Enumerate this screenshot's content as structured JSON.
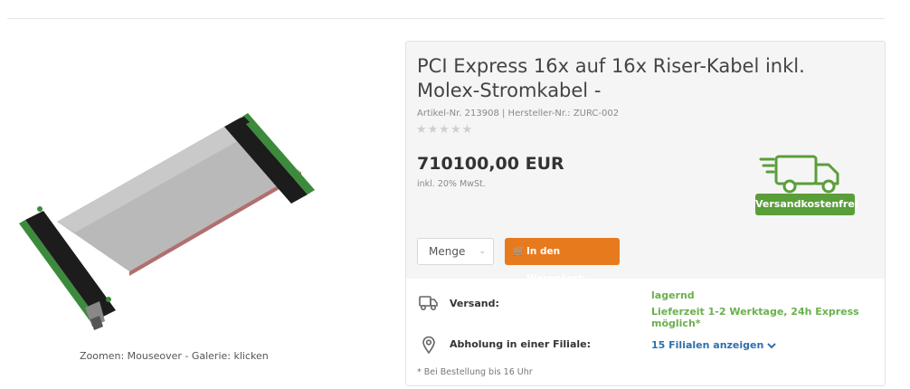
{
  "gallery": {
    "zoom_hint": "Zoomen: Mouseover - Galerie: klicken"
  },
  "product": {
    "title": "PCI Express 16x auf 16x Riser-Kabel inkl. Molex-Stromkabel -",
    "meta": "Artikel-Nr. 213908 | Hersteller-Nr.: ZURC-002",
    "rating_stars": "★★★★★",
    "price": "710100,00 EUR",
    "tax_note": "inkl. 20% MwSt."
  },
  "shipping_badge": {
    "label": "Versandkostenfrei",
    "icon": "delivery-truck-icon",
    "color": "#5a9e3a"
  },
  "purchase": {
    "quantity_label": "Menge",
    "quantity_chevron": "⌄",
    "cart_button_label": "In den Warenkorb",
    "cart_icon": "🛒",
    "accent_color": "#e87a1e"
  },
  "delivery": {
    "shipping_label": "Versand:",
    "stock_status": "lagernd",
    "delivery_time": "Lieferzeit 1-2 Werktage, 24h Express möglich*",
    "pickup_label": "Abholung in einer Filiale:",
    "stores_link": "15 Filialen anzeigen",
    "footnote": "* Bei Bestellung bis 16 Uhr"
  }
}
